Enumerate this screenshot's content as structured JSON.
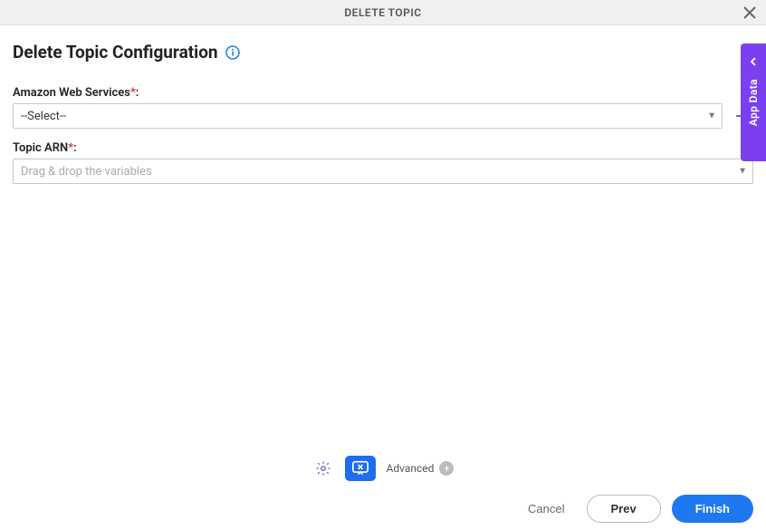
{
  "header": {
    "title": "DELETE TOPIC"
  },
  "page": {
    "title": "Delete Topic Configuration"
  },
  "fields": {
    "aws": {
      "label": "Amazon Web Services",
      "value": "--Select--"
    },
    "topicArn": {
      "label": "Topic ARN",
      "placeholder": "Drag & drop the variables"
    }
  },
  "toolbar": {
    "advanced": "Advanced"
  },
  "buttons": {
    "cancel": "Cancel",
    "prev": "Prev",
    "finish": "Finish"
  },
  "side": {
    "label": "App Data"
  }
}
